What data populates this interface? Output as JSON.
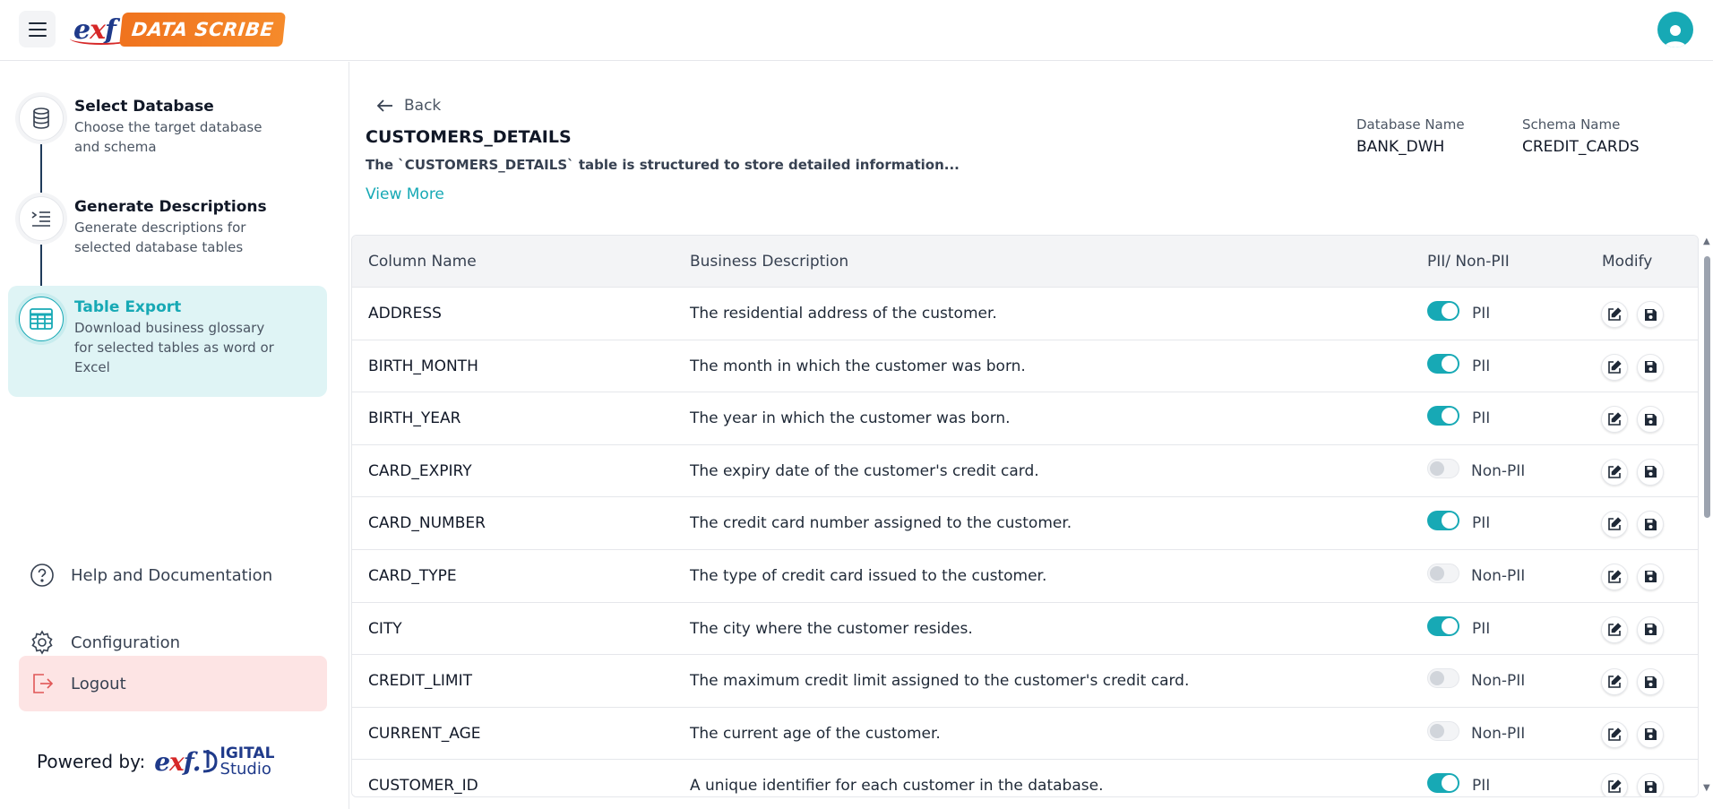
{
  "header": {
    "logo_exf_e": "e",
    "logo_exf_x": "x",
    "logo_exf_f": "f",
    "logo_badge": "DATA SCRIBE"
  },
  "sidebar": {
    "steps": [
      {
        "title": "Select Database",
        "desc": "Choose the target database and schema",
        "icon": "database-icon"
      },
      {
        "title": "Generate Descriptions",
        "desc": "Generate descriptions for selected database tables",
        "icon": "list-indent-icon"
      },
      {
        "title": "Table Export",
        "desc": "Download business glossary for selected tables as word or Excel",
        "icon": "table-icon"
      }
    ],
    "links": {
      "help": "Help and Documentation",
      "config": "Configuration",
      "logout": "Logout"
    },
    "powered_by": "Powered by:",
    "powered_logo_a": "IGITAL",
    "powered_logo_b": "Studio"
  },
  "main": {
    "back": "Back",
    "table_name": "CUSTOMERS_DETAILS",
    "table_desc": "The `CUSTOMERS_DETAILS` table is structured to store detailed information...",
    "view_more": "View More",
    "database_label": "Database Name",
    "database_value": "BANK_DWH",
    "schema_label": "Schema Name",
    "schema_value": "CREDIT_CARDS"
  },
  "table": {
    "headers": {
      "column": "Column Name",
      "desc": "Business Description",
      "pii": "PII/ Non-PII",
      "modify": "Modify"
    },
    "rows": [
      {
        "name": "ADDRESS",
        "desc": "The residential address of the customer.",
        "pii": true,
        "label": "PII"
      },
      {
        "name": "BIRTH_MONTH",
        "desc": "The month in which the customer was born.",
        "pii": true,
        "label": "PII"
      },
      {
        "name": "BIRTH_YEAR",
        "desc": "The year in which the customer was born.",
        "pii": true,
        "label": "PII"
      },
      {
        "name": "CARD_EXPIRY",
        "desc": "The expiry date of the customer's credit card.",
        "pii": false,
        "label": "Non-PII"
      },
      {
        "name": "CARD_NUMBER",
        "desc": "The credit card number assigned to the customer.",
        "pii": true,
        "label": "PII"
      },
      {
        "name": "CARD_TYPE",
        "desc": "The type of credit card issued to the customer.",
        "pii": false,
        "label": "Non-PII"
      },
      {
        "name": "CITY",
        "desc": "The city where the customer resides.",
        "pii": true,
        "label": "PII"
      },
      {
        "name": "CREDIT_LIMIT",
        "desc": "The maximum credit limit assigned to the customer's credit card.",
        "pii": false,
        "label": "Non-PII"
      },
      {
        "name": "CURRENT_AGE",
        "desc": "The current age of the customer.",
        "pii": false,
        "label": "Non-PII"
      },
      {
        "name": "CUSTOMER_ID",
        "desc": "A unique identifier for each customer in the database.",
        "pii": true,
        "label": "PII"
      }
    ]
  },
  "colors": {
    "accent": "#17a9b5",
    "logout_bg": "#fde4e4",
    "active_step_bg": "#dff4f5"
  }
}
